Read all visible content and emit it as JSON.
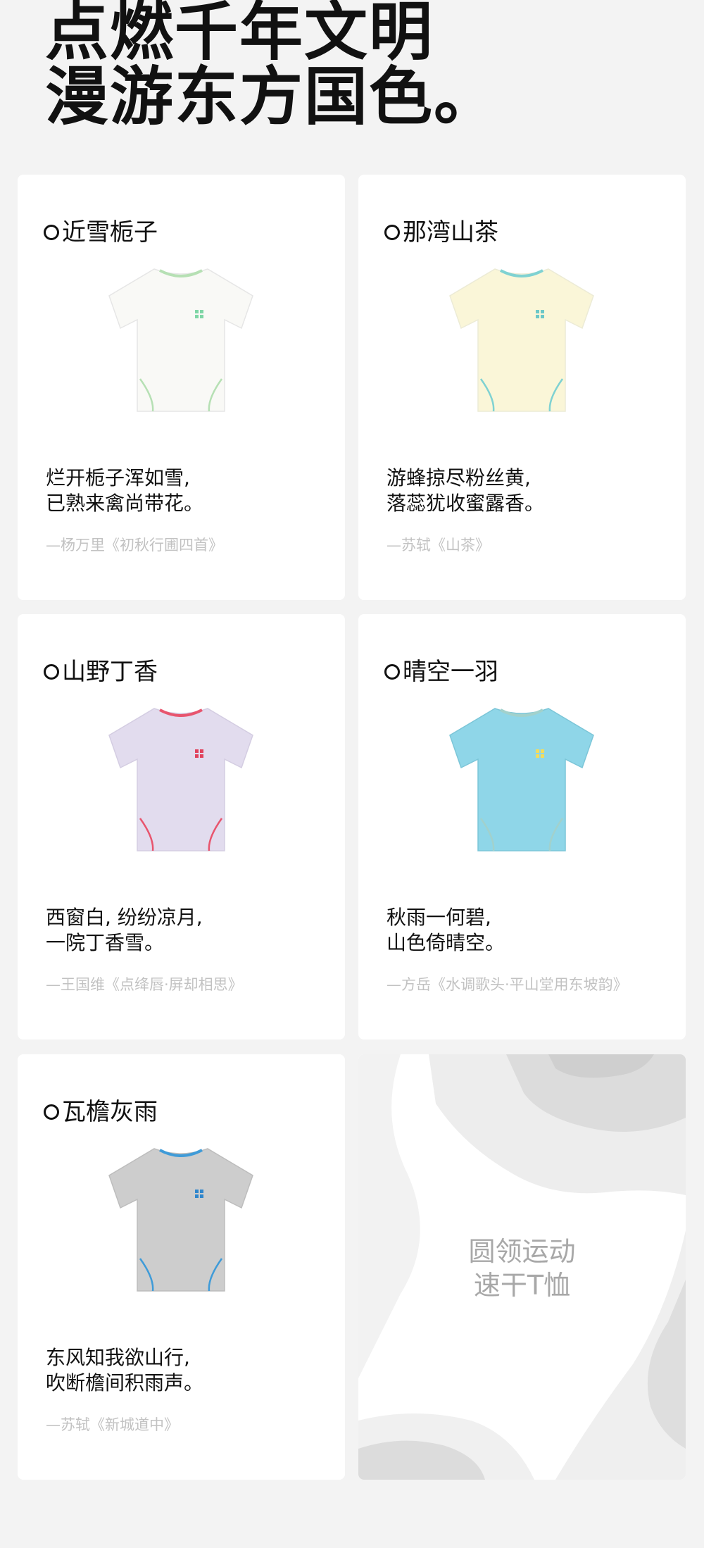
{
  "headline": {
    "line1": "点燃千年文明",
    "line2": "漫游东方国色。"
  },
  "cards": [
    {
      "title": "近雪栀子",
      "body_color": "#f9f9f6",
      "trim_color": "#b6e0b4",
      "logo_color": "#7fd6a6",
      "poem_line1": "烂开栀子浑如雪,",
      "poem_line2": "已熟来禽尚带花。",
      "source": "—杨万里《初秋行圃四首》"
    },
    {
      "title": "那湾山茶",
      "body_color": "#faf6d8",
      "trim_color": "#7fd2d2",
      "logo_color": "#6cc8c8",
      "poem_line1": "游蜂掠尽粉丝黄,",
      "poem_line2": "落蕊犹收蜜露香。",
      "source": "—苏轼《山茶》"
    },
    {
      "title": "山野丁香",
      "body_color": "#e2dcee",
      "trim_color": "#e8556e",
      "logo_color": "#e0425c",
      "poem_line1": "西窗白, 纷纷凉月,",
      "poem_line2": "一院丁香雪。",
      "source": "—王国维《点绛唇·屏却相思》"
    },
    {
      "title": "晴空一羽",
      "body_color": "#8fd6e8",
      "trim_color": "#a2d1cc",
      "logo_color": "#f2dc5e",
      "poem_line1": "秋雨一何碧,",
      "poem_line2": "山色倚晴空。",
      "source": "—方岳《水调歌头·平山堂用东坡韵》"
    },
    {
      "title": "瓦檐灰雨",
      "body_color": "#cdcdcd",
      "trim_color": "#3f9bd8",
      "logo_color": "#2f86cc",
      "poem_line1": "东风知我欲山行,",
      "poem_line2": "吹断檐间积雨声。",
      "source": "—苏轼《新城道中》"
    }
  ],
  "promo": {
    "line1": "圆领运动",
    "line2": "速干T恤"
  }
}
